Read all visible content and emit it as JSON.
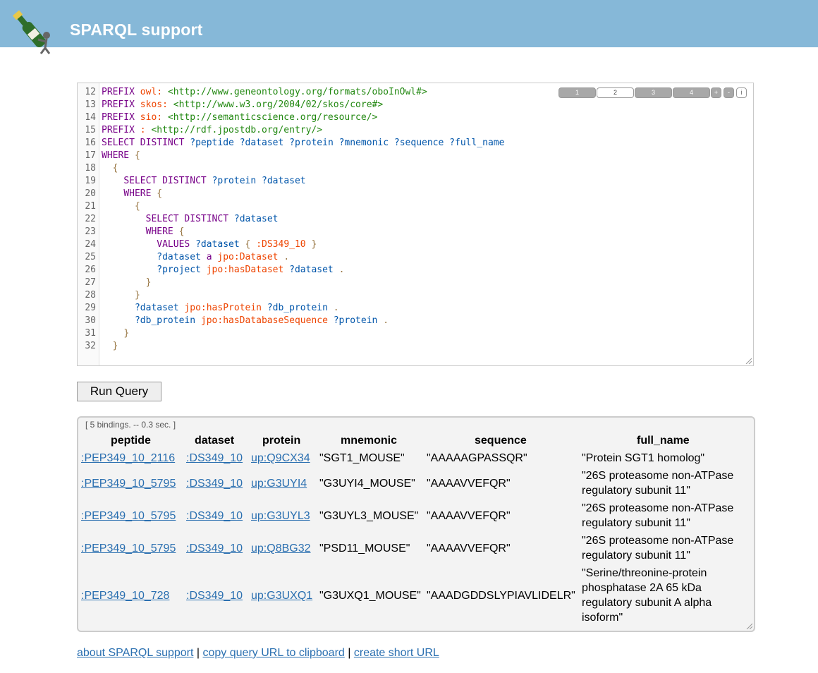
{
  "header": {
    "title": "SPARQL support",
    "logo_icon": "champagne-bottle-icon"
  },
  "editor": {
    "tabs": [
      "1",
      "2",
      "3",
      "4"
    ],
    "active_tab": "2",
    "zoom_in_label": "+",
    "zoom_out_label": "-",
    "info_label": "i",
    "line_numbers": [
      "12",
      "13",
      "14",
      "15",
      "16",
      "17",
      "18",
      "19",
      "20",
      "21",
      "22",
      "23",
      "24",
      "25",
      "26",
      "27",
      "28",
      "29",
      "30",
      "31",
      "32"
    ],
    "lines": [
      "PREFIX owl: <http://www.geneontology.org/formats/oboInOwl#>",
      "PREFIX skos: <http://www.w3.org/2004/02/skos/core#>",
      "PREFIX sio: <http://semanticscience.org/resource/>",
      "PREFIX : <http://rdf.jpostdb.org/entry/>",
      "SELECT DISTINCT ?peptide ?dataset ?protein ?mnemonic ?sequence ?full_name",
      "WHERE {",
      "  {",
      "    SELECT DISTINCT ?protein ?dataset",
      "    WHERE {",
      "      {",
      "        SELECT DISTINCT ?dataset",
      "        WHERE {",
      "          VALUES ?dataset { :DS349_10 }",
      "          ?dataset a jpo:Dataset .",
      "          ?project jpo:hasDataset ?dataset .",
      "        }",
      "      }",
      "      ?dataset jpo:hasProtein ?db_protein .",
      "      ?db_protein jpo:hasDatabaseSequence ?protein .",
      "    }",
      "  }"
    ]
  },
  "run_button": {
    "label": "Run Query"
  },
  "results": {
    "status": "[ 5 bindings. -- 0.3 sec. ]",
    "columns": [
      "peptide",
      "dataset",
      "protein",
      "mnemonic",
      "sequence",
      "full_name"
    ],
    "rows": [
      {
        "peptide": ":PEP349_10_2116",
        "dataset": ":DS349_10",
        "protein": "up:Q9CX34",
        "mnemonic": "\"SGT1_MOUSE\"",
        "sequence": "\"AAAAAGPASSQR\"",
        "full_name": "\"Protein SGT1 homolog\""
      },
      {
        "peptide": ":PEP349_10_5795",
        "dataset": ":DS349_10",
        "protein": "up:G3UYI4",
        "mnemonic": "\"G3UYI4_MOUSE\"",
        "sequence": "\"AAAAVVEFQR\"",
        "full_name": "\"26S proteasome non-ATPase regulatory subunit 11\""
      },
      {
        "peptide": ":PEP349_10_5795",
        "dataset": ":DS349_10",
        "protein": "up:G3UYL3",
        "mnemonic": "\"G3UYL3_MOUSE\"",
        "sequence": "\"AAAAVVEFQR\"",
        "full_name": "\"26S proteasome non-ATPase regulatory subunit 11\""
      },
      {
        "peptide": ":PEP349_10_5795",
        "dataset": ":DS349_10",
        "protein": "up:Q8BG32",
        "mnemonic": "\"PSD11_MOUSE\"",
        "sequence": "\"AAAAVVEFQR\"",
        "full_name": "\"26S proteasome non-ATPase regulatory subunit 11\""
      },
      {
        "peptide": ":PEP349_10_728",
        "dataset": ":DS349_10",
        "protein": "up:G3UXQ1",
        "mnemonic": "\"G3UXQ1_MOUSE\"",
        "sequence": "\"AAADGDDSLYPIAVLIDELR\"",
        "full_name": "\"Serine/threonine-protein phosphatase 2A 65 kDa regulatory subunit A alpha isoform\""
      }
    ]
  },
  "footer": {
    "about_link": "about SPARQL support",
    "copy_link": "copy query URL to clipboard",
    "short_url_link": "create short URL",
    "separator": "|"
  },
  "colors": {
    "header": "#86b8d8",
    "link": "#2a6fb0",
    "keyword": "#770088",
    "variable": "#0055aa",
    "iri": "#228811",
    "property": "#ee4400"
  }
}
